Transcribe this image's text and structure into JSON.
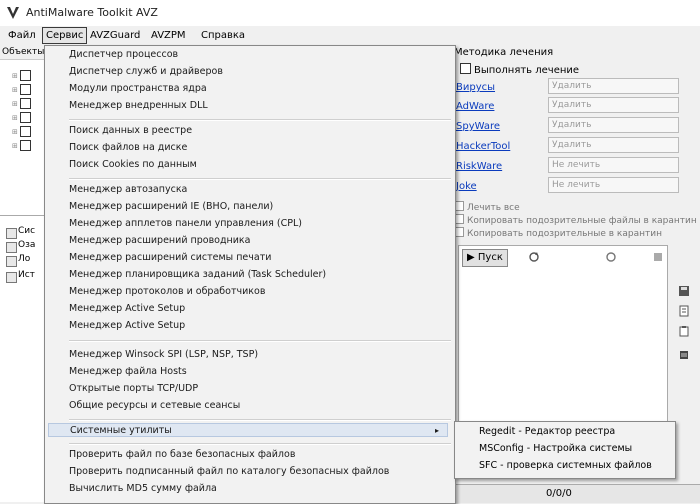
{
  "window": {
    "title": "AntiMalware Toolkit AVZ"
  },
  "menubar": {
    "items": [
      "Файл",
      "Сервис",
      "AVZGuard",
      "AVZPM",
      "Справка"
    ]
  },
  "left_panel": {
    "header": "Объекты",
    "tree_item_count": 6,
    "lower_rows": [
      "Сис",
      "Оза",
      "Ло",
      "Ист"
    ]
  },
  "service_menu": {
    "groups": [
      [
        "Диспетчер процессов",
        "Диспетчер служб и драйверов",
        "Модули пространства ядра",
        "Менеджер внедренных DLL"
      ],
      [
        "Поиск данных в реестре",
        "Поиск файлов на диске",
        "Поиск Cookies по данным"
      ],
      [
        "Менеджер автозапуска",
        "Менеджер расширений IE (BHO, панели)",
        "Менеджер апплетов панели управления (CPL)",
        "Менеджер расширений проводника",
        "Менеджер расширений системы печати",
        "Менеджер планировщика заданий (Task Scheduler)",
        "Менеджер протоколов и обработчиков",
        "Менеджер Active Setup",
        "Менеджер Active Setup"
      ],
      [
        "Менеджер Winsock SPI (LSP, NSP, TSP)",
        "Менеджер файла Hosts",
        "Открытые порты TCP/UDP",
        "Общие ресурсы и сетевые сеансы"
      ]
    ],
    "submenu_parent": "Системные утилиты",
    "footer_items": [
      "Проверить файл по базе безопасных файлов",
      "Проверить подписанный файл по каталогу безопасных файлов",
      "Вычислить MD5 сумму файла"
    ]
  },
  "system_utils_submenu": {
    "items": [
      {
        "name": "Regedit",
        "desc": "Редактор реестра"
      },
      {
        "name": "MSConfig",
        "desc": "Настройка системы"
      },
      {
        "name": "SFC",
        "desc": "проверка системных файлов"
      }
    ]
  },
  "right_panel": {
    "header": "Методика лечения",
    "checkbox_label": "Выполнять лечение",
    "threat_links": [
      "Вирусы",
      "AdWare",
      "SpyWare",
      "HackerTool",
      "RiskWare",
      "Joke"
    ],
    "field_values": [
      "Удалить",
      "Удалить",
      "Удалить",
      "Удалить",
      "Не лечить",
      "Не лечить"
    ],
    "options": [
      "Лечить все",
      "Копировать подозрительные файлы в карантин",
      "Копировать подозрительные в карантин"
    ],
    "start_button": "Пуск",
    "status_text": "0/0/0"
  }
}
